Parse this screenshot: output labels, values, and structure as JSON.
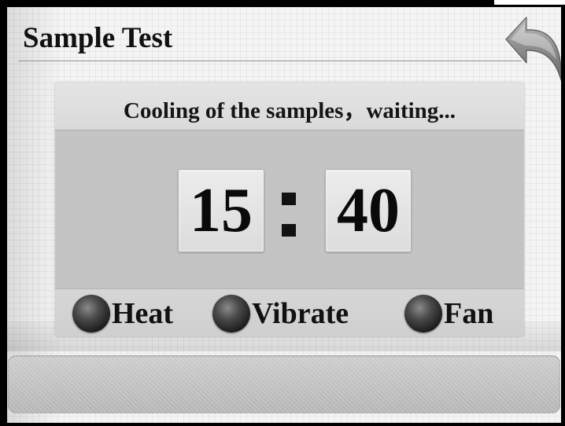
{
  "header": {
    "title": "Sample Test",
    "back_icon": "back-arrow-icon"
  },
  "status": {
    "message": "Cooling of the samples，waiting..."
  },
  "timer": {
    "minutes": "15",
    "separator": ":",
    "seconds": "40"
  },
  "indicators": [
    {
      "label": "Heat",
      "state": "off"
    },
    {
      "label": "Vibrate",
      "state": "off"
    },
    {
      "label": "Fan",
      "state": "off"
    }
  ],
  "message_bar": {
    "text": ""
  },
  "colors": {
    "background": "#f4f4f4",
    "panel": "#c4c4c4",
    "led_off": "#1a1a1a",
    "text": "#111111"
  }
}
